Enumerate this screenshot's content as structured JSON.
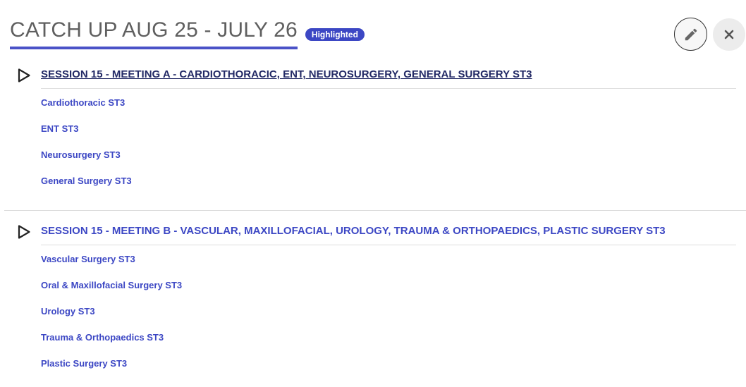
{
  "header": {
    "title": "CATCH UP AUG 25 - JULY 26",
    "badge": "Highlighted"
  },
  "actions": {
    "edit_icon": "pencil-icon",
    "close_icon": "close-icon"
  },
  "sessions": [
    {
      "title": "SESSION 15 - MEETING A - CARDIOTHORACIC, ENT, NEUROSURGERY, GENERAL SURGERY ST3",
      "icon": "play-icon",
      "items": [
        "Cardiothoracic ST3",
        "ENT ST3",
        "Neurosurgery ST3",
        "General Surgery ST3"
      ]
    },
    {
      "title": "SESSION 15 - MEETING B - VASCULAR, MAXILLOFACIAL, UROLOGY, TRAUMA & ORTHOPAEDICS, PLASTIC SURGERY ST3",
      "icon": "play-icon",
      "items": [
        "Vascular Surgery ST3",
        "Oral & Maxillofacial Surgery ST3",
        "Urology ST3",
        "Trauma & Orthopaedics ST3",
        "Plastic Surgery ST3"
      ]
    }
  ],
  "colors": {
    "accent": "#3c47c4",
    "title_text": "#5f5f5f",
    "session_title_dark": "#232a66"
  }
}
